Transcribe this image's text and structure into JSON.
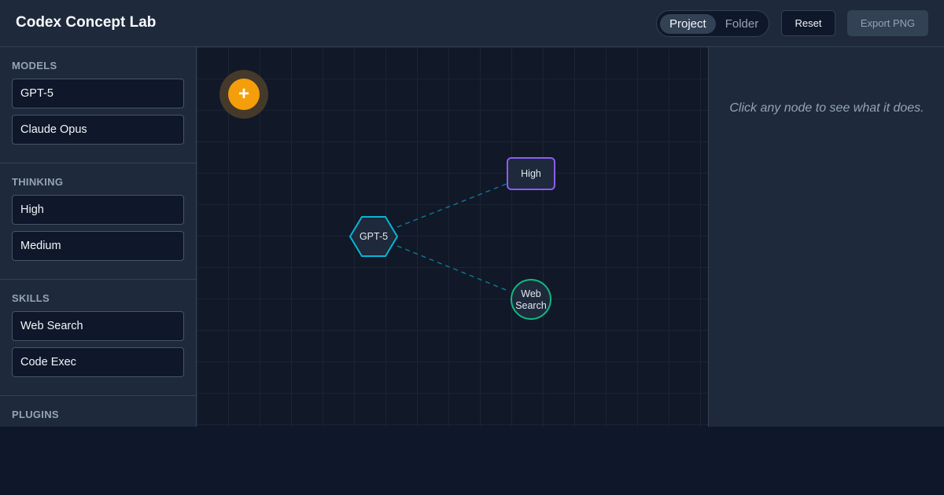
{
  "app": {
    "title": "Codex Concept Lab"
  },
  "toolbar": {
    "mode_options": [
      "Project",
      "Folder"
    ],
    "mode_selected": "Project",
    "reset_label": "Reset",
    "export_label": "Export PNG"
  },
  "sidebar": {
    "sections": [
      {
        "title": "MODELS",
        "items": [
          "GPT-5",
          "Claude Opus"
        ]
      },
      {
        "title": "THINKING",
        "items": [
          "High",
          "Medium"
        ]
      },
      {
        "title": "SKILLS",
        "items": [
          "Web Search",
          "Code Exec"
        ]
      },
      {
        "title": "PLUGINS",
        "items": []
      }
    ]
  },
  "canvas": {
    "add_button_glyph": "+",
    "nodes": [
      {
        "label": "GPT-5",
        "shape": "hexagon",
        "color": "#06b6d4"
      },
      {
        "label": "High",
        "shape": "rounded-rect",
        "color": "#8b5cf6"
      },
      {
        "label_lines": [
          "Web",
          "Search"
        ],
        "shape": "circle",
        "color": "#10b981"
      }
    ],
    "edge_color": "#0e7490",
    "add_color": "#f59e0b"
  },
  "details": {
    "hint": "Click any node to see what it does."
  }
}
